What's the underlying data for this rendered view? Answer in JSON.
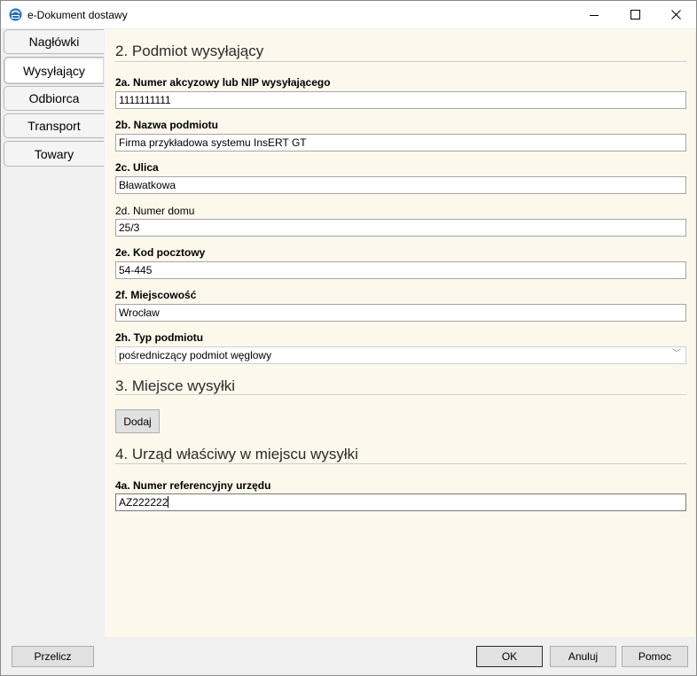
{
  "window": {
    "title": "e-Dokument dostawy",
    "app_icon": "insert-gt-icon"
  },
  "tabs": [
    {
      "label": "Nagłówki"
    },
    {
      "label": "Wysyłający",
      "active": true
    },
    {
      "label": "Odbiorca"
    },
    {
      "label": "Transport"
    },
    {
      "label": "Towary"
    }
  ],
  "section2": {
    "title": "2. Podmiot wysyłający",
    "fields": [
      {
        "label": "2a. Numer akcyzowy lub NIP wysyłającego",
        "value": "1111111111",
        "required": true
      },
      {
        "label": "2b. Nazwa podmiotu",
        "value": "Firma przykładowa systemu InsERT GT",
        "required": true
      },
      {
        "label": "2c. Ulica",
        "value": "Bławatkowa",
        "required": true
      },
      {
        "label": "2d. Numer domu",
        "value": "25/3",
        "required": false
      },
      {
        "label": "2e. Kod pocztowy",
        "value": "54-445",
        "required": true
      },
      {
        "label": "2f. Miejscowość",
        "value": "Wrocław",
        "required": true
      },
      {
        "label": "2h. Typ podmiotu",
        "value": "pośredniczący podmiot węglowy",
        "required": true,
        "type": "dropdown"
      }
    ]
  },
  "section3": {
    "title": "3. Miejsce wysyłki",
    "add_button": "Dodaj"
  },
  "section4": {
    "title": "4. Urząd właściwy w miejscu wysyłki",
    "field": {
      "label": "4a. Numer referencyjny urzędu",
      "value": "AZ222222"
    }
  },
  "footer": {
    "recalc": "Przelicz",
    "ok": "OK",
    "cancel": "Anuluj",
    "help": "Pomoc"
  }
}
